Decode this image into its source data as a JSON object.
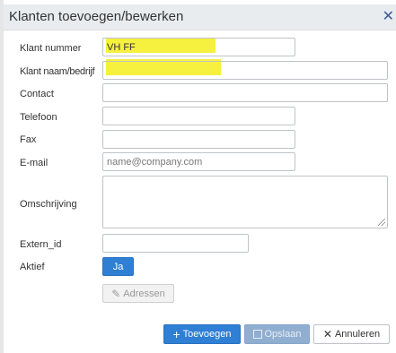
{
  "dialog": {
    "title": "Klanten toevoegen/bewerken",
    "close_icon": "close-icon"
  },
  "form": {
    "klant_nummer": {
      "label": "Klant nummer",
      "value": "VH FF"
    },
    "klant_naam": {
      "label": "Klant naam/bedrijf",
      "value": ""
    },
    "contact": {
      "label": "Contact",
      "value": ""
    },
    "telefoon": {
      "label": "Telefoon",
      "value": ""
    },
    "fax": {
      "label": "Fax",
      "value": ""
    },
    "email": {
      "label": "E-mail",
      "value": "",
      "placeholder": "name@company.com"
    },
    "omschrijving": {
      "label": "Omschrijving",
      "value": ""
    },
    "extern_id": {
      "label": "Extern_id",
      "value": ""
    },
    "aktief": {
      "label": "Aktief",
      "toggle_label": "Ja"
    }
  },
  "buttons": {
    "adressen": "Adressen",
    "toevoegen": "Toevoegen",
    "opslaan": "Opslaan",
    "annuleren": "Annuleren"
  },
  "colors": {
    "primary": "#2f7fd4",
    "highlight": "#f5ef2a",
    "titlebar": "#e9ecef"
  }
}
